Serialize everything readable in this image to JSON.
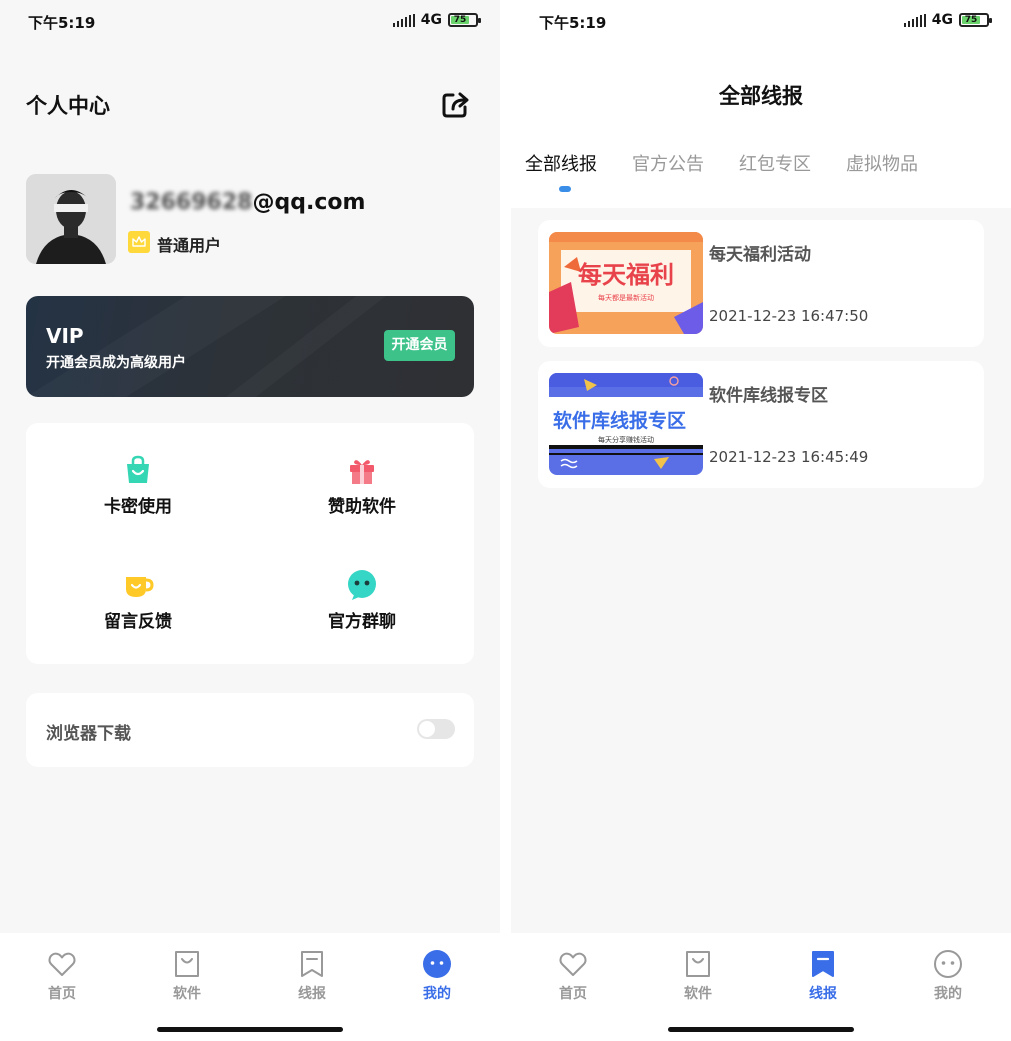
{
  "status_bar": {
    "time": "下午5:19",
    "network": "4G",
    "battery": "75"
  },
  "left": {
    "title": "个人中心",
    "profile": {
      "email_hidden": "32669628",
      "email_tail": "@qq.com",
      "user_type": "普通用户"
    },
    "vip": {
      "title": "VIP",
      "subtitle": "开通会员成为高级用户",
      "button": "开通会员"
    },
    "grid": [
      {
        "label": "卡密使用",
        "icon": "bag-icon",
        "color": "#35d6b3"
      },
      {
        "label": "赞助软件",
        "icon": "gift-icon",
        "color": "#f25a6b"
      },
      {
        "label": "留言反馈",
        "icon": "cup-icon",
        "color": "#ffc928"
      },
      {
        "label": "官方群聊",
        "icon": "chat-icon",
        "color": "#35d6c5"
      }
    ],
    "setting": {
      "label": "浏览器下载",
      "enabled": false
    }
  },
  "tabbar": {
    "items": [
      {
        "label": "首页",
        "icon": "heart-icon"
      },
      {
        "label": "软件",
        "icon": "bag-icon"
      },
      {
        "label": "线报",
        "icon": "bookmark-icon"
      },
      {
        "label": "我的",
        "icon": "smile-icon"
      }
    ],
    "active_left": "我的",
    "active_right": "线报",
    "active_color": "#3a6ee8"
  },
  "right": {
    "title": "全部线报",
    "tabs": [
      "全部线报",
      "官方公告",
      "红包专区",
      "虚拟物品"
    ],
    "active_tab": "全部线报",
    "news": [
      {
        "title": "每天福利活动",
        "time": "2021-12-23 16:47:50",
        "thumb_text": "每天福利",
        "thumb_sub": "每天都是最新活动"
      },
      {
        "title": "软件库线报专区",
        "time": "2021-12-23 16:45:49",
        "thumb_text": "软件库线报专区",
        "thumb_sub": "每天分享赚钱活动"
      }
    ]
  }
}
